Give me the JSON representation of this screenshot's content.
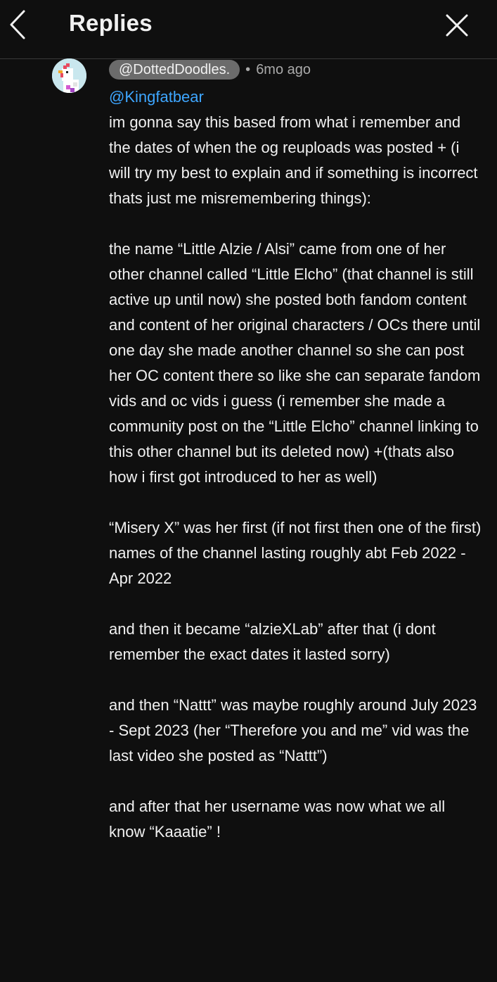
{
  "header": {
    "title": "Replies"
  },
  "reply": {
    "author": "@DottedDoodles.",
    "separator": "•",
    "time": "6mo ago",
    "mention": "@Kingfatbear",
    "paragraphs": [
      "im gonna say this based from what i remember and the dates of when the og reuploads was posted + (i will try my best to explain and if something is incorrect thats just me misremembering things):",
      "the name “Little Alzie / Alsi” came from one of her other channel called “Little Elcho” (that channel is still active up until now) she posted both fandom content and content of her original characters / OCs there until one day she made  another channel so she can post her OC content there so like she can separate fandom vids and oc vids i guess (i remember she made a community post on the “Little Elcho” channel linking to this other channel but its deleted now) +(thats also how i first got introduced to her as well)",
      "“Misery X” was her first (if not first then one of the first) names of the channel lasting roughly abt Feb 2022 - Apr 2022",
      "and then it became “alzieXLab” after that (i dont remember the exact dates it lasted sorry)",
      "and then “Nattt” was maybe roughly around July 2023 - Sept 2023 (her “Therefore you and me” vid was the last video she posted as “Nattt”)",
      "and after that her username was now what we all know “Kaaatie” !"
    ]
  },
  "colors": {
    "background": "#0f0f0f",
    "text": "#f1f1f1",
    "secondary": "#aaaaaa",
    "mention": "#3ea6ff",
    "chip": "#6b6b6b"
  },
  "icons": [
    "back-chevron-icon",
    "close-icon",
    "chicken-avatar"
  ]
}
